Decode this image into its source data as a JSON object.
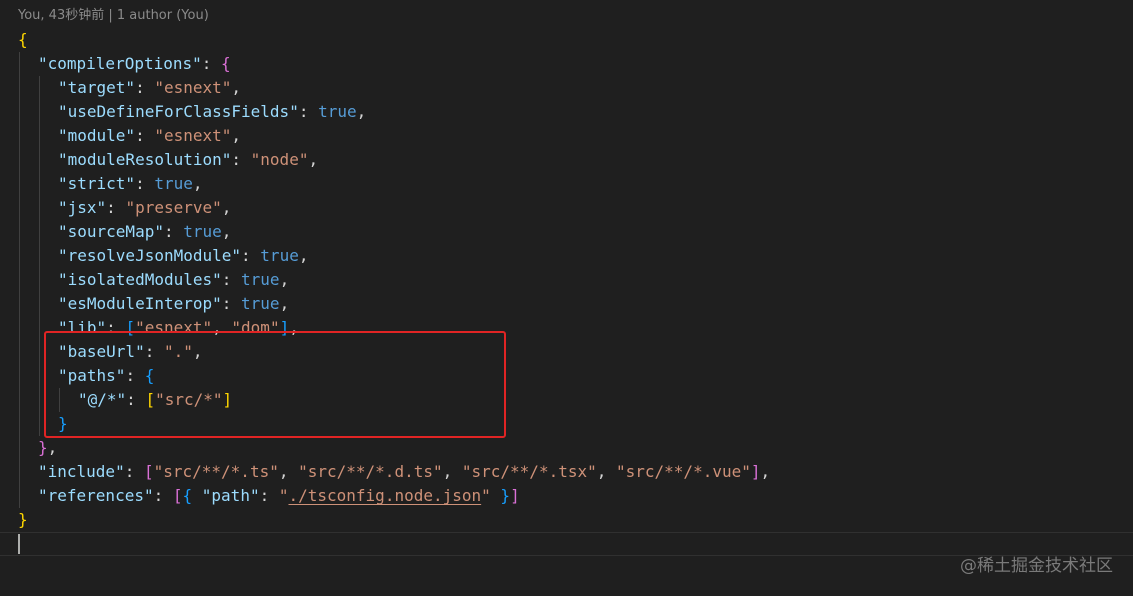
{
  "codelens": {
    "blame_text": "You, 43秒钟前 | 1 author (You)"
  },
  "colors": {
    "background": "#1f1f1f",
    "json_key": "#9cdcfe",
    "string": "#ce9178",
    "boolean": "#569cd6",
    "bracket_level1": "#ffd700",
    "bracket_level2": "#da70d6",
    "bracket_level3": "#179fff",
    "highlight_box": "#e02424"
  },
  "code": {
    "open_brace": "{",
    "compilerOptions_key": "\"compilerOptions\"",
    "target_key": "\"target\"",
    "target_val": "\"esnext\"",
    "useDefine_key": "\"useDefineForClassFields\"",
    "useDefine_val": "true",
    "module_key": "\"module\"",
    "module_val": "\"esnext\"",
    "moduleResolution_key": "\"moduleResolution\"",
    "moduleResolution_val": "\"node\"",
    "strict_key": "\"strict\"",
    "strict_val": "true",
    "jsx_key": "\"jsx\"",
    "jsx_val": "\"preserve\"",
    "sourceMap_key": "\"sourceMap\"",
    "sourceMap_val": "true",
    "resolveJson_key": "\"resolveJsonModule\"",
    "resolveJson_val": "true",
    "isolated_key": "\"isolatedModules\"",
    "isolated_val": "true",
    "esInterop_key": "\"esModuleInterop\"",
    "esInterop_val": "true",
    "lib_key": "\"lib\"",
    "lib_val1": "\"esnext\"",
    "lib_val2": "\"dom\"",
    "baseUrl_key": "\"baseUrl\"",
    "baseUrl_val": "\".\"",
    "paths_key": "\"paths\"",
    "alias_key": "\"@/*\"",
    "alias_val": "\"src/*\"",
    "include_key": "\"include\"",
    "include_val1": "\"src/**/*.ts\"",
    "include_val2": "\"src/**/*.d.ts\"",
    "include_val3": "\"src/**/*.tsx\"",
    "include_val4": "\"src/**/*.vue\"",
    "references_key": "\"references\"",
    "path_key": "\"path\"",
    "path_val_open": "\"",
    "path_val_link": "./tsconfig.node.json",
    "path_val_close": "\"",
    "close_brace": "}"
  },
  "watermark": "@稀土掘金技术社区"
}
